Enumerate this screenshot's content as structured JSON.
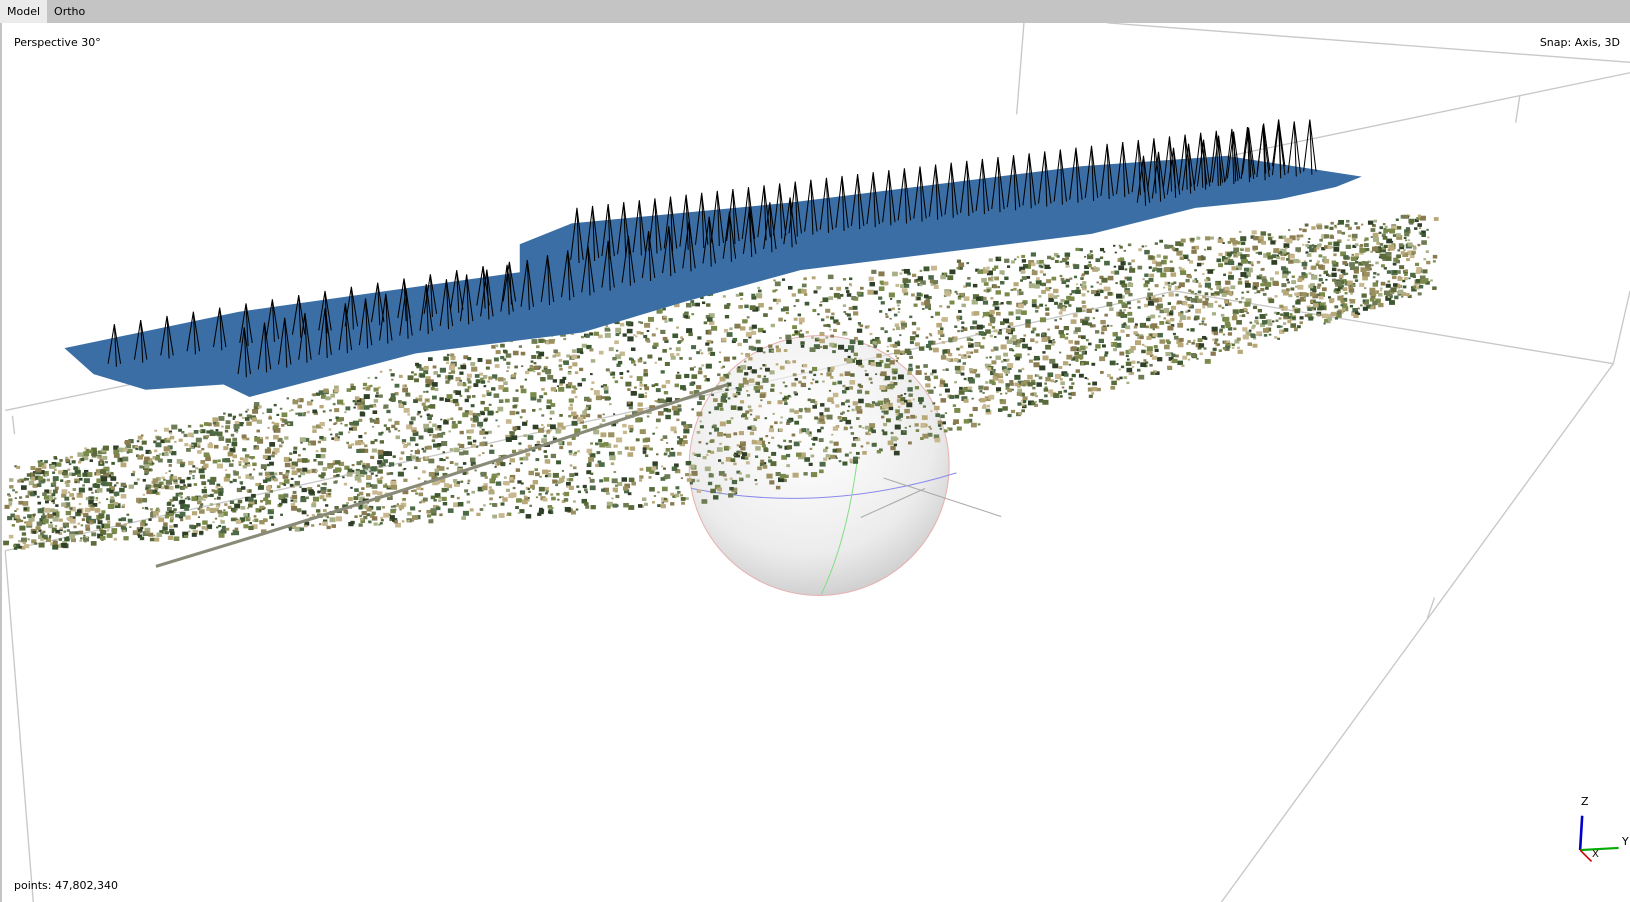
{
  "tabs": [
    {
      "label": "Model",
      "active": true
    },
    {
      "label": "Ortho",
      "active": false
    }
  ],
  "viewport": {
    "projection_label": "Perspective 30°",
    "snap_label": "Snap: Axis, 3D",
    "points_label": "points: 47,802,340"
  },
  "axis_gizmo": {
    "x": "X",
    "y": "Y",
    "z": "Z"
  },
  "colors": {
    "tabbar": "#c4c4c4",
    "active_tab": "#ebebeb",
    "plane": "#3a6ea5",
    "bbox": "#c8c8c8",
    "axis_x": "#cc0000",
    "axis_y": "#00aa00",
    "axis_z": "#0000cc"
  }
}
